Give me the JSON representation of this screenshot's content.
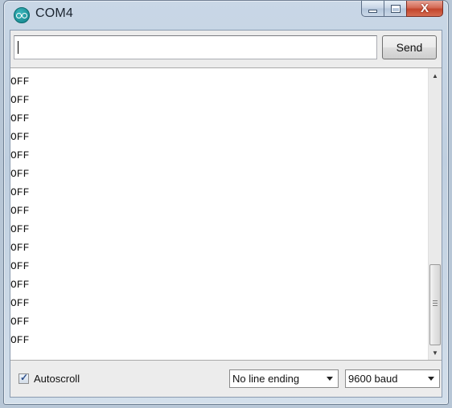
{
  "window": {
    "title": "COM4",
    "app_icon": "arduino-icon",
    "caption_buttons": {
      "minimize_icon": "minimize-icon",
      "maximize_icon": "maximize-icon",
      "close_label": "X"
    }
  },
  "input_row": {
    "input_value": "",
    "send_label": "Send"
  },
  "output": {
    "lines": [
      "OFF",
      "OFF",
      "OFF",
      "OFF",
      "OFF",
      "OFF",
      "OFF",
      "OFF",
      "OFF",
      "OFF",
      "OFF",
      "OFF",
      "OFF",
      "OFF",
      "OFF"
    ]
  },
  "footer": {
    "autoscroll_label": "Autoscroll",
    "autoscroll_checked": true,
    "line_ending_selected": "No line ending",
    "baud_selected": "9600 baud"
  },
  "colors": {
    "window_frame": "#c9d7e6",
    "close_button": "#c2452c",
    "app_icon": "#0f7f86"
  }
}
